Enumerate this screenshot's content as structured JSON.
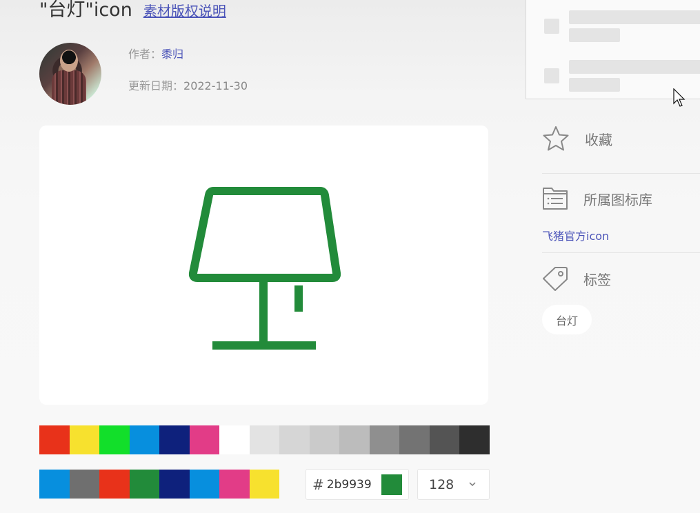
{
  "header": {
    "title": "\"台灯\"icon",
    "copyright_link": "素材版权说明"
  },
  "author": {
    "label": "作者：",
    "name": "黍归"
  },
  "updated": {
    "label": "更新日期：",
    "date": "2022-11-30"
  },
  "icon": {
    "name": "lamp-icon",
    "color": "#2b9939"
  },
  "palette": {
    "row1": [
      "#e8321a",
      "#f7e12e",
      "#12df2a",
      "#078fde",
      "#0e217c",
      "#e23c87",
      "#ffffff",
      "#e3e3e3",
      "#d6d6d6",
      "#cacaca",
      "#bcbcbc",
      "#8f8f8f",
      "#737373",
      "#545454",
      "#2e2e2e"
    ],
    "row2": [
      "#078fde",
      "#6f6f6f",
      "#e8321a",
      "#228b3a",
      "#0e217c",
      "#078fde",
      "#e23c87",
      "#f7e12e"
    ]
  },
  "color_input": {
    "hash": "#",
    "value": "2b9939",
    "preview_color": "#228b3a"
  },
  "size_select": {
    "value": "128"
  },
  "sidebar": {
    "favorite_label": "收藏",
    "library_label": "所属图标库",
    "library_name": "飞猪官方icon",
    "tags_label": "标签",
    "tags": [
      "台灯"
    ]
  }
}
